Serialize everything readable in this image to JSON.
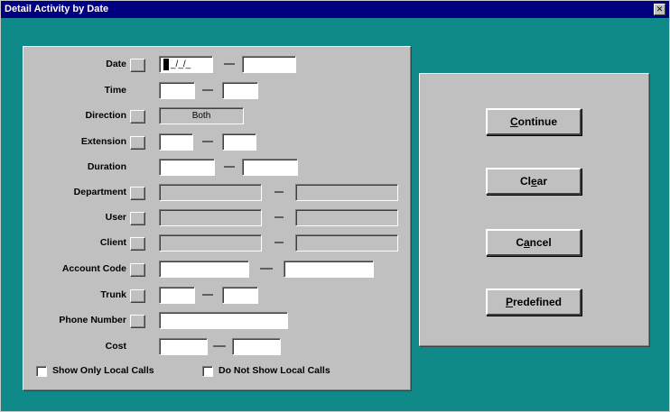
{
  "window": {
    "title": "Detail Activity by Date",
    "close_glyph": "✕"
  },
  "form": {
    "date_label": "Date",
    "date_from_value": "_/_/_",
    "time_label": "Time",
    "direction_label": "Direction",
    "direction_value": "Both",
    "extension_label": "Extension",
    "duration_label": "Duration",
    "department_label": "Department",
    "user_label": "User",
    "client_label": "Client",
    "account_code_label": "Account Code",
    "trunk_label": "Trunk",
    "phone_number_label": "Phone Number",
    "cost_label": "Cost",
    "show_only_local_label": "Show Only Local Calls",
    "do_not_show_local_label": "Do Not Show Local Calls"
  },
  "actions": {
    "continue_prefix": "",
    "continue_mnemonic": "C",
    "continue_rest": "ontinue",
    "clear_prefix": "Cl",
    "clear_mnemonic": "e",
    "clear_rest": "ar",
    "cancel_prefix": "C",
    "cancel_mnemonic": "a",
    "cancel_rest": "ncel",
    "predefined_prefix": "",
    "predefined_mnemonic": "P",
    "predefined_rest": "redefined"
  },
  "colors": {
    "titlebar": "#000080",
    "background": "#0f8a88",
    "panel": "#c0c0c0"
  }
}
